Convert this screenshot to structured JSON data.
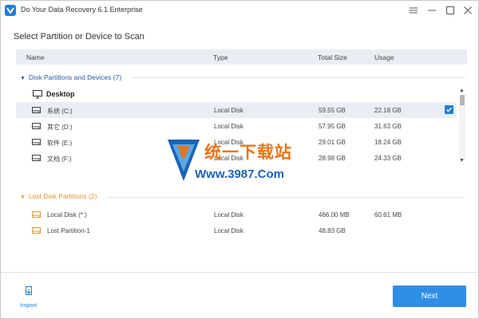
{
  "window": {
    "title": "Do Your Data Recovery 6.1 Enterprise"
  },
  "heading": "Select Partition or Device to Scan",
  "columns": {
    "name": "Name",
    "type": "Type",
    "total_size": "Total Size",
    "usage": "Usage"
  },
  "disk_partitions": {
    "label": "Disk Partitions and Devices (7)",
    "device": "Desktop",
    "rows": [
      {
        "name": "系统 (C:)",
        "type": "Local Disk",
        "total_size": "59.55 GB",
        "usage": "22.18 GB",
        "selected": true
      },
      {
        "name": "其它 (D:)",
        "type": "Local Disk",
        "total_size": "57.95 GB",
        "usage": "31.63 GB",
        "selected": false
      },
      {
        "name": "软件 (E:)",
        "type": "Local Disk",
        "total_size": "29.01 GB",
        "usage": "18.24 GB",
        "selected": false
      },
      {
        "name": "文档 (F:)",
        "type": "Local Disk",
        "total_size": "28.98 GB",
        "usage": "24.33 GB",
        "selected": false
      }
    ]
  },
  "lost_partitions": {
    "label": "Lost Disk Partitions (2)",
    "rows": [
      {
        "name": "Local Disk (*:)",
        "type": "Local Disk",
        "total_size": "466.00 MB",
        "usage": "60.61 MB"
      },
      {
        "name": "Lost Partition-1",
        "type": "Local Disk",
        "total_size": "48.83 GB",
        "usage": ""
      }
    ]
  },
  "watermark": {
    "title": "统一下载站",
    "url": "Www.3987.Com"
  },
  "footer": {
    "import_label": "Import",
    "next_label": "Next"
  },
  "colors": {
    "accent": "#1e7fd6",
    "lost_group": "#e8922a",
    "disk_group": "#2a5ca8"
  }
}
